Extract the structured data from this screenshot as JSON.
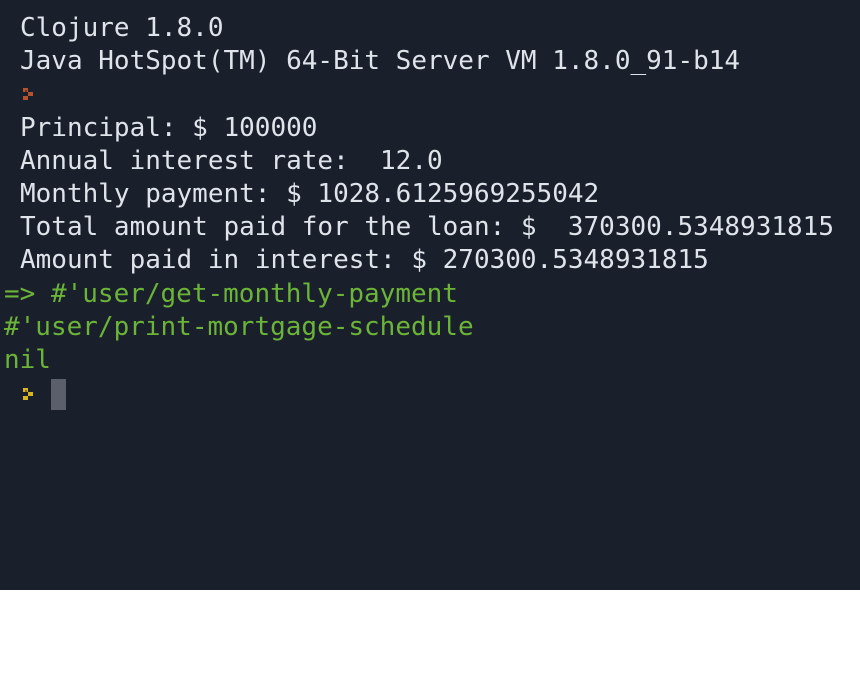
{
  "terminal": {
    "header_lines": [
      "Clojure 1.8.0",
      "Java HotSpot(TM) 64-Bit Server VM 1.8.0_91-b14"
    ],
    "output_lines": [
      "Principal: $ 100000",
      "Annual interest rate:  12.0",
      "Monthly payment: $ 1028.6125969255042",
      "Total amount paid for the loan: $  370300.5348931815",
      "Amount paid in interest: $ 270300.5348931815"
    ],
    "result_lines": [
      "=> #'user/get-monthly-payment",
      "#'user/print-mortgage-schedule",
      "nil"
    ],
    "colors": {
      "background": "#1a1f2c",
      "output_text": "#dfe3ea",
      "result_text": "#6bb437",
      "first_prompt": "#b5532c",
      "second_prompt": "#d9b51e",
      "cursor": "#5a5f6b"
    },
    "prompt_icon": "prompt-chevron-icon"
  }
}
